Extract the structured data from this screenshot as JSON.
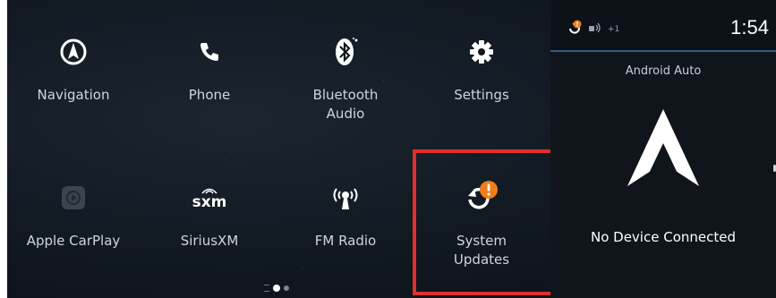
{
  "apps": {
    "navigation": "Navigation",
    "phone": "Phone",
    "bluetooth_line1": "Bluetooth",
    "bluetooth_line2": "Audio",
    "settings": "Settings",
    "carplay": "Apple CarPlay",
    "siriusxm": "SiriusXM",
    "siriusxm_logo": "sxm",
    "fm": "FM Radio",
    "updates_line1": "System",
    "updates_line2": "Updates"
  },
  "status": {
    "clock": "1:54",
    "extra": "+1"
  },
  "android_auto": {
    "title": "Android Auto",
    "message": "No Device Connected"
  },
  "colors": {
    "highlight": "#e0302a",
    "badge": "#f07d1a"
  }
}
